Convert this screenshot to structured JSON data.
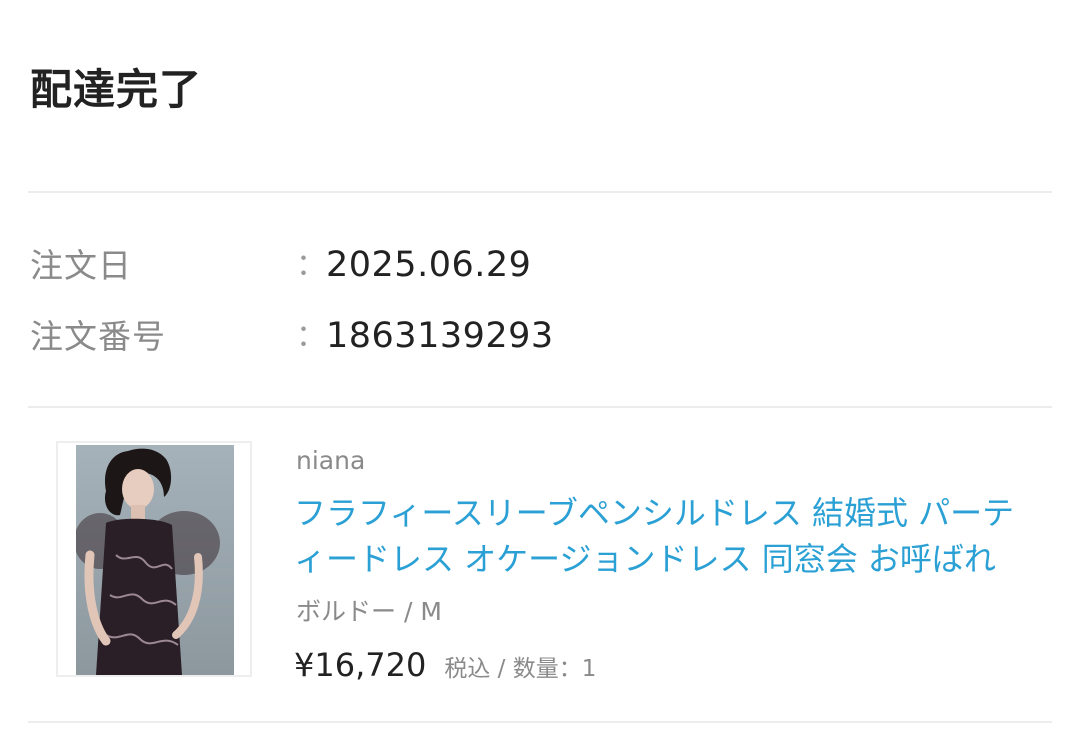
{
  "order": {
    "status_title": "配達完了",
    "date_label": "注文日",
    "date_sep": "：",
    "date_value": "2025.06.29",
    "number_label": "注文番号",
    "number_sep": "：",
    "number_value": "1863139293"
  },
  "item": {
    "image_icon": "product-photo",
    "brand": "niana",
    "name": "フラフィースリーブペンシルドレス 結婚式 パーティードレス オケージョンドレス 同窓会 お呼ばれ",
    "variant": "ボルドー / M",
    "price": "¥16,720",
    "price_meta": "税込 / 数量：1"
  },
  "colors": {
    "link": "#2aa0d4",
    "muted": "#8a8a8a",
    "text": "#222222",
    "divider": "#ececec"
  }
}
